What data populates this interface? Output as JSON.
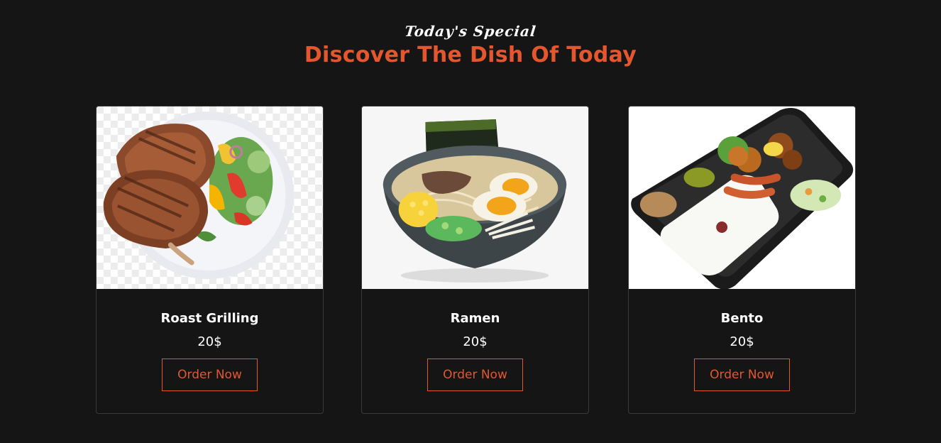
{
  "section": {
    "subtitle": "Today's Special",
    "title": "Discover The Dish Of Today"
  },
  "colors": {
    "background": "#151515",
    "accent": "#e4572e",
    "text": "#ffffff",
    "card_border": "#3a3a3a"
  },
  "dishes": [
    {
      "image": "roast-grilling-photo",
      "name": "Roast Grilling",
      "price": "20$",
      "button": "Order Now"
    },
    {
      "image": "ramen-photo",
      "name": "Ramen",
      "price": "20$",
      "button": "Order Now"
    },
    {
      "image": "bento-photo",
      "name": "Bento",
      "price": "20$",
      "button": "Order Now"
    }
  ]
}
